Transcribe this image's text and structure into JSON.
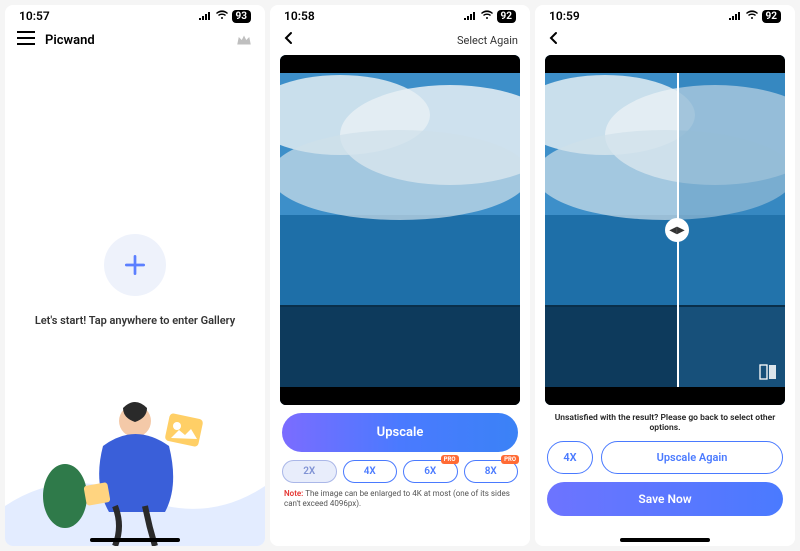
{
  "screen1": {
    "status": {
      "time": "10:57",
      "battery": "93"
    },
    "app_title": "Picwand",
    "prompt": "Let's start! Tap anywhere to enter Gallery"
  },
  "screen2": {
    "status": {
      "time": "10:58",
      "battery": "92"
    },
    "select_again": "Select Again",
    "upscale_label": "Upscale",
    "options": {
      "x2": "2X",
      "x4": "4X",
      "x6": "6X",
      "x8": "8X",
      "pro": "PRO"
    },
    "note_label": "Note:",
    "note_body": " The image can be enlarged to 4K at most (one of its sides can't exceed 4096px)."
  },
  "screen3": {
    "status": {
      "time": "10:59",
      "battery": "92"
    },
    "result_msg": "Unsatisfied with the result? Please go back to select other options.",
    "x4": "4X",
    "upscale_again": "Upscale Again",
    "save_now": "Save Now"
  }
}
